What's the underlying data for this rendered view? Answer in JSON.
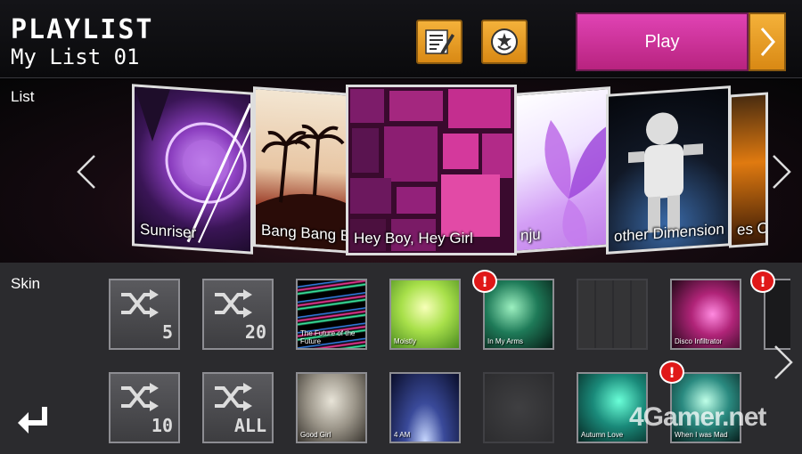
{
  "header": {
    "title": "PLAYLIST",
    "subtitle": "My List 01",
    "play_label": "Play",
    "edit_icon": "edit-list-icon",
    "face_icon": "smile-star-icon"
  },
  "list": {
    "label": "List",
    "songs": [
      {
        "title": "Sunriser"
      },
      {
        "title": "Bang Bang B"
      },
      {
        "title": "Hey Boy, Hey Girl"
      },
      {
        "title": "nju"
      },
      {
        "title": "other Dimension"
      },
      {
        "title": "es Of"
      }
    ]
  },
  "skin": {
    "label": "Skin",
    "row1": [
      {
        "type": "shuffle",
        "value": "5"
      },
      {
        "type": "shuffle",
        "value": "20"
      },
      {
        "type": "skin",
        "caption": "The Future of the Future"
      },
      {
        "type": "skin",
        "caption": "Moistly"
      },
      {
        "type": "skin",
        "caption": "In My Arms",
        "badge": "!"
      },
      {
        "type": "skin",
        "caption": "",
        "dim": true
      },
      {
        "type": "skin",
        "caption": "Disco Infiltrator",
        "badge": "!"
      }
    ],
    "row2": [
      {
        "type": "shuffle",
        "value": "10"
      },
      {
        "type": "shuffle",
        "value": "ALL"
      },
      {
        "type": "skin",
        "caption": "Good Girl"
      },
      {
        "type": "skin",
        "caption": "4 AM"
      },
      {
        "type": "skin",
        "caption": "",
        "dim": true
      },
      {
        "type": "skin",
        "caption": "Autumn Love"
      },
      {
        "type": "skin",
        "caption": "When I was Mad",
        "badge": "!"
      }
    ]
  },
  "watermark": "4Gamer.net",
  "colors": {
    "accent_orange": "#e89a22",
    "play_magenta": "#cf3399",
    "badge_red": "#e01818"
  }
}
